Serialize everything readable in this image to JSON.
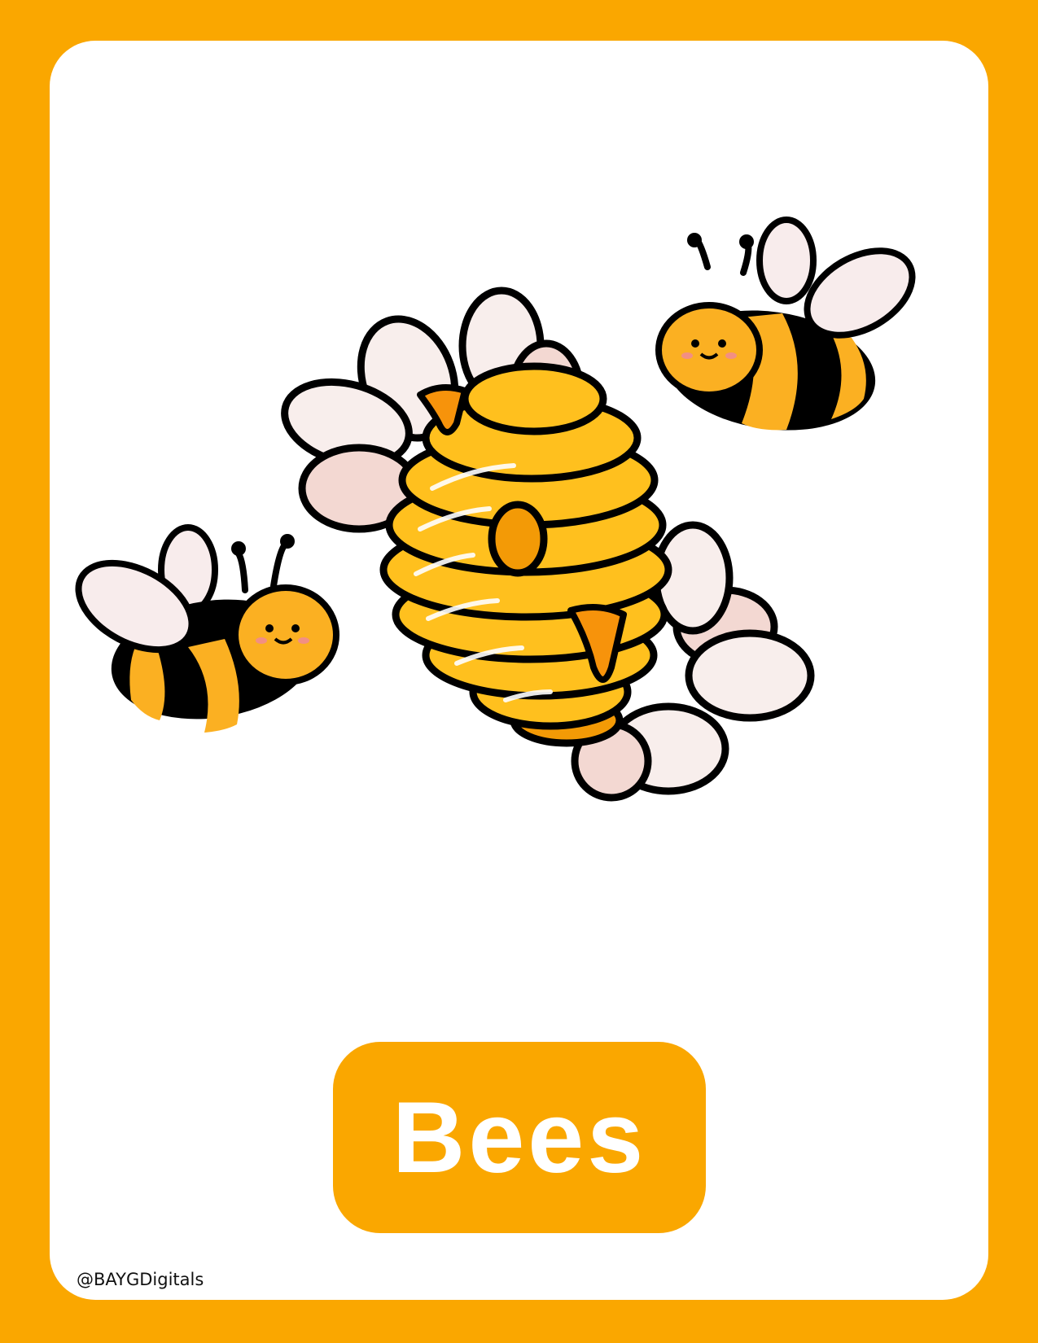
{
  "title": "Bees",
  "credit": "@BAYGDigitals",
  "colors": {
    "frame": "#FAA700",
    "card": "#FFFFFF",
    "label_text": "#FFFFFF",
    "outline": "#000000",
    "hive_light": "#FFC01E",
    "hive_dark": "#F39A06",
    "honey": "#F7930B",
    "petal": "#F8EEEC",
    "petal_shadow": "#F3D8D2",
    "bee_yellow": "#FBB022",
    "bee_black": "#000000",
    "wing": "#F8ECEC",
    "cheek": "#F28F83"
  },
  "illustration": {
    "subject": "beehive with flowers and two bees",
    "icons": [
      "beehive-icon",
      "flower-icon",
      "bee-icon"
    ]
  }
}
